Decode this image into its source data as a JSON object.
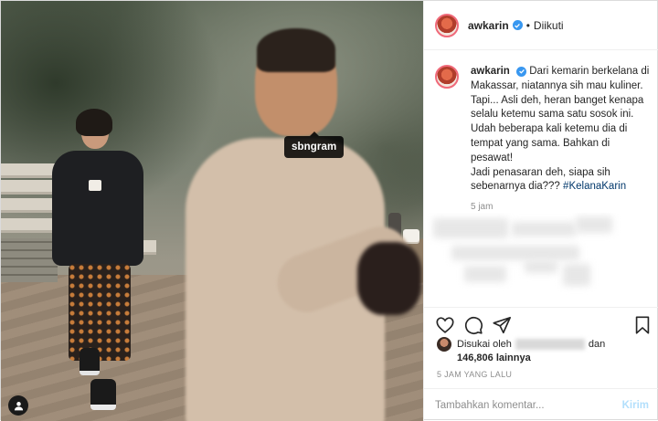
{
  "photo": {
    "tag_label": "sbngram",
    "user_tag_icon": "person-icon"
  },
  "header": {
    "username": "awkarin",
    "separator": "•",
    "follow_status": "Diikuti",
    "verified_icon": "verified-badge-icon"
  },
  "caption": {
    "username": "awkarin",
    "text": "Dari kemarin berkelana di Makassar, niatannya sih mau kuliner. Tapi... Asli deh, heran banget kenapa selalu ketemu sama satu sosok ini. Udah beberapa kali ketemu dia di tempat yang sama. Bahkan di pesawat!",
    "text2": "Jadi penasaran deh, siapa sih sebenarnya dia???",
    "hashtag": "#KelanaKarin",
    "time": "5 jam"
  },
  "actions": {
    "like_icon": "heart-icon",
    "comment_icon": "comment-icon",
    "share_icon": "send-icon",
    "save_icon": "bookmark-icon"
  },
  "likes": {
    "prefix": "Disukai oleh",
    "connector": "dan",
    "count": "146,806",
    "suffix": "lainnya"
  },
  "posted": "5 JAM YANG LALU",
  "comment": {
    "placeholder": "Tambahkan komentar...",
    "submit_label": "Kirim"
  },
  "colors": {
    "accent_link": "#00376b",
    "verified": "#3897f0",
    "submit_disabled": "#b2dffc"
  }
}
